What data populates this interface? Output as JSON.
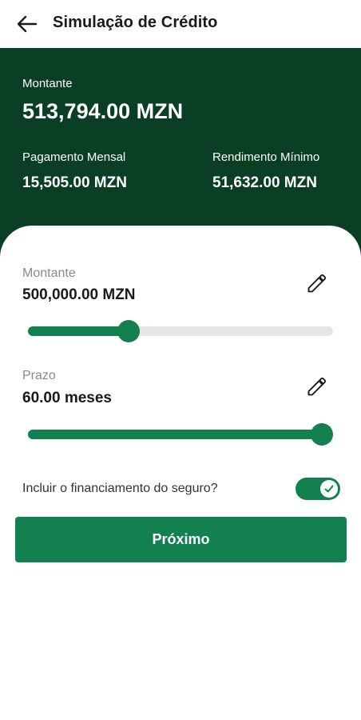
{
  "header": {
    "title": "Simulação de Crédito"
  },
  "summary": {
    "amount_label": "Montante",
    "amount_value": "513,794.00 MZN",
    "monthly_label": "Pagamento Mensal",
    "monthly_value": "15,505.00 MZN",
    "min_income_label": "Rendimento Mínimo",
    "min_income_value": "51,632.00 MZN"
  },
  "form": {
    "amount": {
      "label": "Montante",
      "value": "500,000.00 MZN",
      "slider_fraction": 0.33
    },
    "term": {
      "label": "Prazo",
      "value": "60.00 meses",
      "slider_fraction": 1.0
    },
    "insurance": {
      "label": "Incluir o financiamento do seguro?",
      "enabled": true
    },
    "next_label": "Próximo"
  },
  "colors": {
    "primary": "#138050",
    "header_bg": "#0a3f26"
  }
}
